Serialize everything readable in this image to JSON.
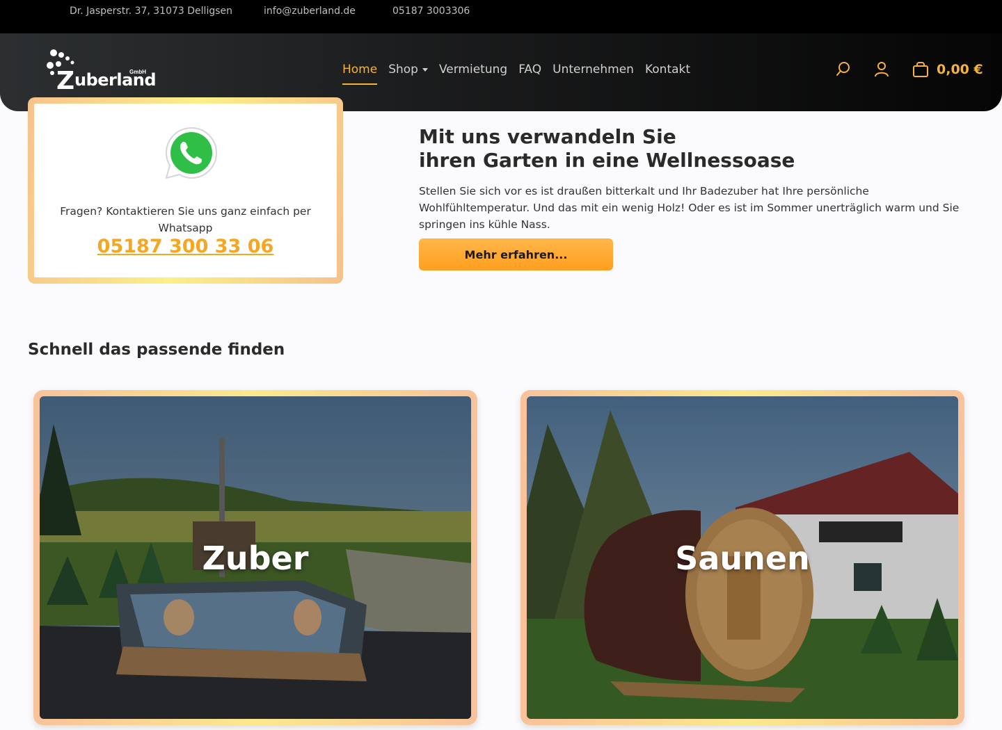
{
  "topbar": {
    "address": "Dr. Jasperstr. 37, 31073 Delligsen",
    "email": "info@zuberland.de",
    "phone": "05187 3003306"
  },
  "header": {
    "logo_text": "uberland",
    "logo_letter": "Z",
    "logo_suffix": "GmbH",
    "nav": [
      {
        "label": "Home",
        "active": true
      },
      {
        "label": "Shop",
        "dropdown": true
      },
      {
        "label": "Vermietung"
      },
      {
        "label": "FAQ"
      },
      {
        "label": "Unternehmen"
      },
      {
        "label": "Kontakt"
      }
    ],
    "icons": [
      "search-icon",
      "user-icon",
      "cart-icon"
    ],
    "cart_total": "0,00 €"
  },
  "whatsapp_box": {
    "icon": "whatsapp-icon",
    "text": "Fragen? Kontaktieren Sie uns ganz einfach per Whatsapp",
    "phone": "05187 300 33 06"
  },
  "hero": {
    "title_line1": "Mit uns verwandeln Sie",
    "title_line2": "ihren Garten in eine Wellnessoase",
    "text": "Stellen Sie sich vor es ist draußen bitterkalt und Ihr Badezuber hat Ihre persönliche Wohlfühltemperatur. Und das mit ein wenig Holz! Oder es ist im Sommer unerträglich warm und Sie springen ins kühle Nass.",
    "button": "Mehr erfahren..."
  },
  "finder": {
    "title": "Schnell das passende finden",
    "cards": [
      {
        "label": "Zuber"
      },
      {
        "label": "Saunen"
      }
    ]
  },
  "colors": {
    "accent": "#f6b33b",
    "button": "#ffa730",
    "navbar": "#1a1b1c"
  }
}
